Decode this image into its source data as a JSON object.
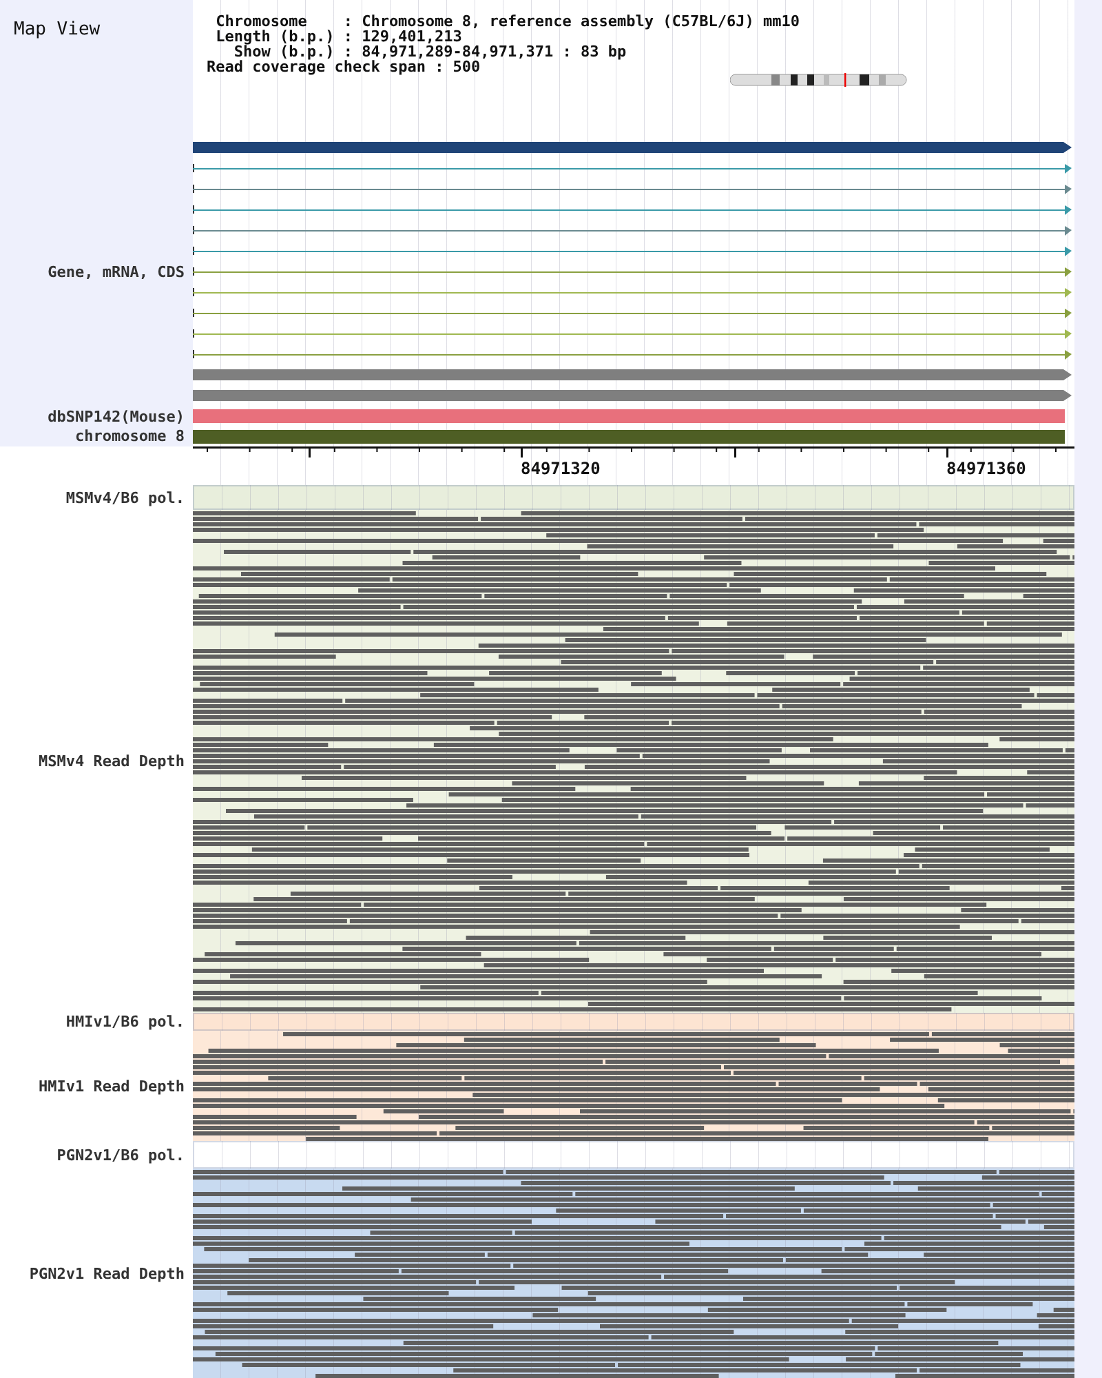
{
  "title": "Map View",
  "info": [
    "Chromosome    : Chromosome 8, reference assembly (C57BL/6J) mm10",
    "Length (b.p.) : 129,401,213",
    "Show (b.p.) : 84,971,289-84,971,371 : 83 bp",
    "Read coverage check span : 500"
  ],
  "tracks": [
    {
      "kind": "gene",
      "label": "Gene, mRNA, CDS",
      "features": [
        {
          "kind": "thick",
          "color": "#1f4477"
        },
        {
          "kind": "thin",
          "color": "#3a9aa8"
        },
        {
          "kind": "thin",
          "color": "#6a8a90"
        },
        {
          "kind": "thin",
          "color": "#3a9aa8"
        },
        {
          "kind": "thin",
          "color": "#6a8a90"
        },
        {
          "kind": "thin",
          "color": "#3a9aa8"
        },
        {
          "kind": "thin",
          "color": "#8aa040"
        },
        {
          "kind": "thin",
          "color": "#a0b850"
        },
        {
          "kind": "thin",
          "color": "#8aa040"
        },
        {
          "kind": "thin",
          "color": "#a0b850"
        },
        {
          "kind": "thin",
          "color": "#8aa040"
        },
        {
          "kind": "thick",
          "color": "#7f7f7f"
        },
        {
          "kind": "thick",
          "color": "#7f7f7f"
        }
      ]
    },
    {
      "kind": "bar",
      "label": "dbSNP142(Mouse)",
      "color": "#e8707c"
    },
    {
      "kind": "bar",
      "label": "chromosome 8",
      "color": "#4e5e24"
    },
    {
      "kind": "ruler",
      "labels": [
        "84971320",
        "84971360"
      ]
    },
    {
      "kind": "pol",
      "label": "MSMv4/B6 pol.",
      "color": "#e8eedc"
    },
    {
      "kind": "depth",
      "label": "MSMv4 Read Depth",
      "color": "#eef2e2"
    },
    {
      "kind": "pol",
      "label": "HMIv1/B6 pol.",
      "color": "#fde4d2"
    },
    {
      "kind": "depth",
      "label": "HMIv1 Read Depth",
      "color": "#fde8d8"
    },
    {
      "kind": "pol",
      "label": "PGN2v1/B6 pol.",
      "color": "#ffffff"
    },
    {
      "kind": "depth",
      "label": "PGN2v1 Read Depth",
      "color": "#c8daf0"
    }
  ]
}
